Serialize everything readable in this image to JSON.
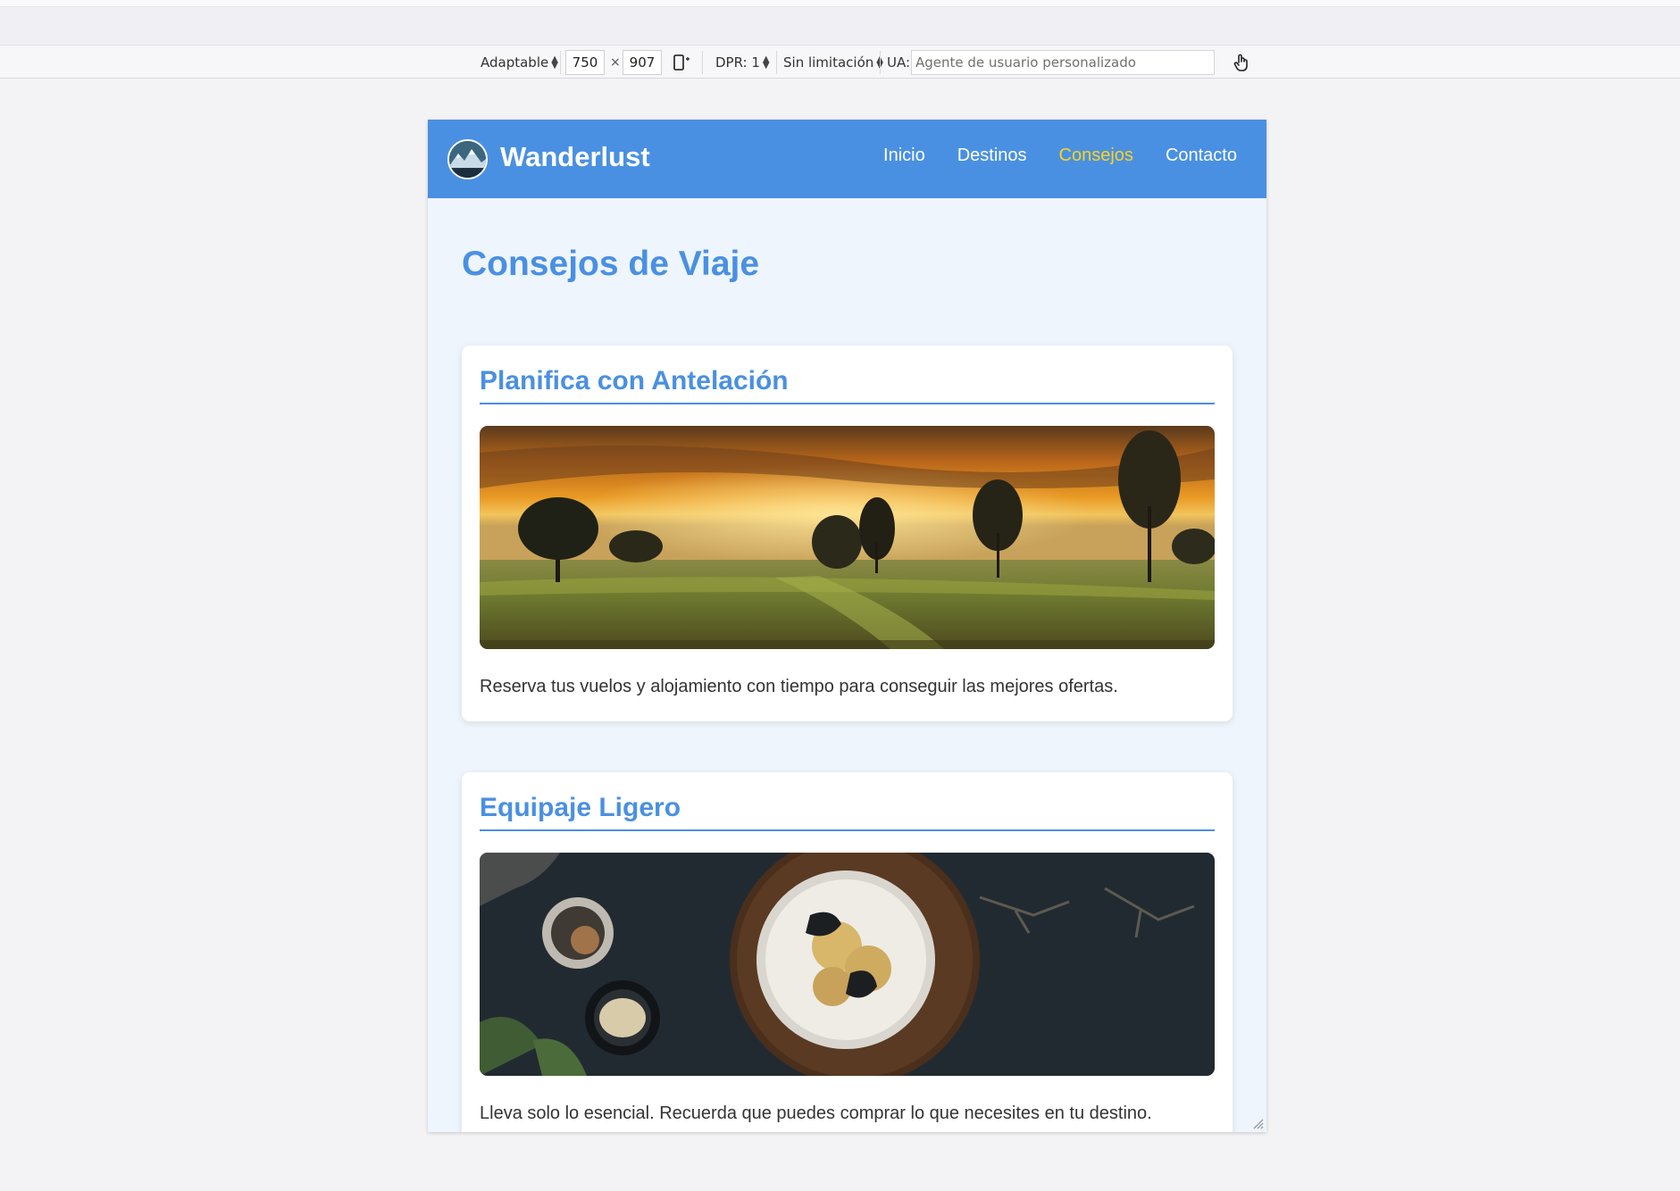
{
  "toolbar": {
    "device_mode": "Adaptable",
    "width": "750",
    "times": "×",
    "height": "907",
    "dpr": "DPR: 1",
    "throttle": "Sin limitación",
    "ua_label": "UA:",
    "ua_placeholder": "Agente de usuario personalizado"
  },
  "site": {
    "brand": "Wanderlust",
    "nav": [
      {
        "label": "Inicio",
        "active": false
      },
      {
        "label": "Destinos",
        "active": false
      },
      {
        "label": "Consejos",
        "active": true
      },
      {
        "label": "Contacto",
        "active": false
      }
    ],
    "accent_color": "#4a90e2",
    "active_nav_color": "#ffd21f"
  },
  "page": {
    "title": "Consejos de Viaje",
    "cards": [
      {
        "heading": "Planifica con Antelación",
        "image": "sunset-countryside-photo",
        "text": "Reserva tus vuelos y alojamiento con tiempo para conseguir las mejores ofertas."
      },
      {
        "heading": "Equipaje Ligero",
        "image": "dessert-table-photo",
        "text": "Lleva solo lo esencial. Recuerda que puedes comprar lo que necesites en tu destino."
      }
    ]
  }
}
